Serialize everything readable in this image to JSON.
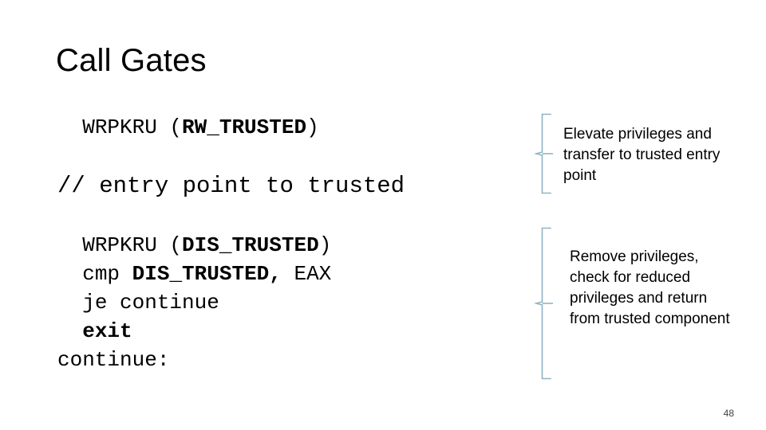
{
  "slide": {
    "title": "Call Gates",
    "page_number": "48",
    "background_color": "#ffffff",
    "brace_color": "#91b3c4",
    "text_color": "#000000"
  },
  "code_block_1": {
    "lines": [
      {
        "indent": "  ",
        "segments": [
          {
            "text": "WRPKRU (",
            "bold": false
          },
          {
            "text": "RW_TRUSTED",
            "bold": true
          },
          {
            "text": ")",
            "bold": false
          }
        ],
        "size": "small"
      },
      {
        "indent": "",
        "segments": [
          {
            "text": "// entry point to trusted",
            "bold": false
          }
        ],
        "size": "large"
      }
    ]
  },
  "code_block_2": {
    "lines": [
      {
        "indent": "  ",
        "segments": [
          {
            "text": "WRPKRU (",
            "bold": false
          },
          {
            "text": "DIS_TRUSTED",
            "bold": true
          },
          {
            "text": ")",
            "bold": false
          }
        ],
        "size": "small"
      },
      {
        "indent": "  ",
        "segments": [
          {
            "text": "cmp ",
            "bold": false
          },
          {
            "text": "DIS_TRUSTED,",
            "bold": true
          },
          {
            "text": " EAX",
            "bold": false
          }
        ],
        "size": "small"
      },
      {
        "indent": "  ",
        "segments": [
          {
            "text": "je continue",
            "bold": false
          }
        ],
        "size": "small"
      },
      {
        "indent": "  ",
        "segments": [
          {
            "text": "exit",
            "bold": true
          }
        ],
        "size": "small"
      },
      {
        "indent": "",
        "segments": [
          {
            "text": "continue:",
            "bold": false
          }
        ],
        "size": "small"
      }
    ]
  },
  "notes": {
    "note_1": "Elevate privileges and transfer to trusted entry point",
    "note_2": "Remove privileges, check for reduced privileges and return from trusted component"
  }
}
